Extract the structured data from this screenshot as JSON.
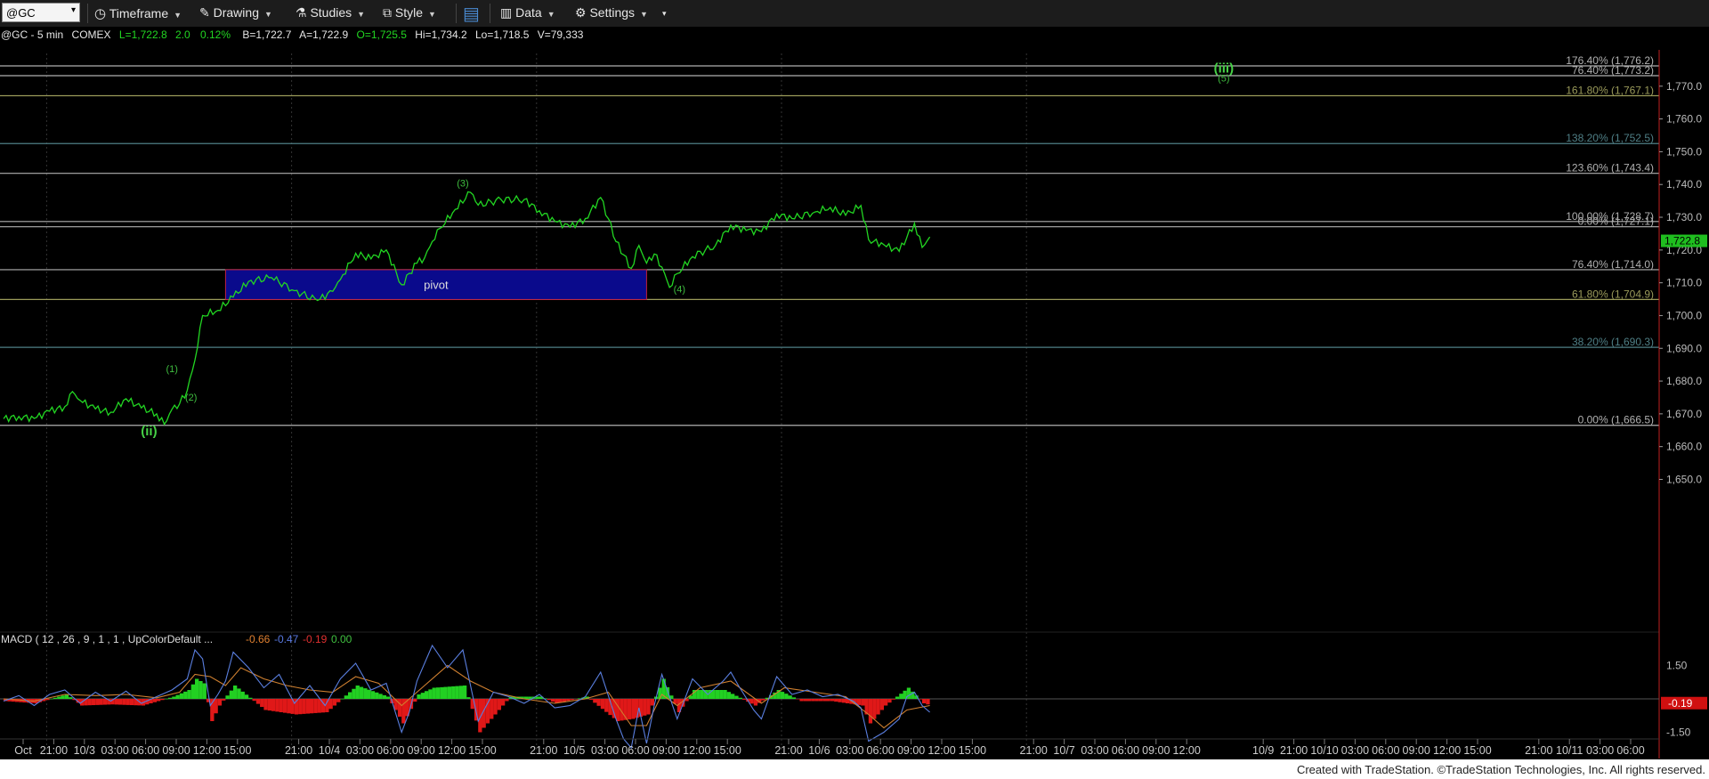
{
  "toolbar": {
    "symbol": "@GC",
    "timeframe_label": "Timeframe",
    "drawing_label": "Drawing",
    "studies_label": "Studies",
    "style_label": "Style",
    "data_label": "Data",
    "settings_label": "Settings"
  },
  "header": {
    "instrument": "@GC - 5 min",
    "exchange": "COMEX",
    "last": "L=1,722.8",
    "change": "2.0",
    "pct": "0.12%",
    "bid": "B=1,722.7",
    "ask": "A=1,722.9",
    "open": "O=1,725.5",
    "high": "Hi=1,734.2",
    "low": "Lo=1,718.5",
    "volume": "V=79,333"
  },
  "footer_text": "Created with TradeStation. ©TradeStation Technologies, Inc. All rights reserved.",
  "chart_data": {
    "type": "line",
    "ylim": [
      1636,
      1780
    ],
    "y_ticks": [
      "1,770.0",
      "1,760.0",
      "1,750.0",
      "1,740.0",
      "1,730.0",
      "1,720.0",
      "1,710.0",
      "1,700.0",
      "1,690.0",
      "1,680.0",
      "1,670.0",
      "1,660.0",
      "1,650.0"
    ],
    "y_tick_values": [
      1770,
      1760,
      1750,
      1740,
      1730,
      1720,
      1710,
      1700,
      1690,
      1680,
      1670,
      1660,
      1650
    ],
    "last_price_label": "1,722.8",
    "last_price": 1722.8,
    "x_labels": [
      "Oct",
      "21:00",
      "10/3",
      "03:00",
      "06:00",
      "09:00",
      "12:00",
      "15:00",
      "21:00",
      "10/4",
      "03:00",
      "06:00",
      "09:00",
      "12:00",
      "15:00",
      "21:00",
      "10/5",
      "03:00",
      "06:00",
      "09:00",
      "12:00",
      "15:00",
      "21:00",
      "10/6",
      "03:00",
      "06:00",
      "09:00",
      "12:00",
      "15:00",
      "21:00",
      "10/7",
      "03:00",
      "06:00",
      "09:00",
      "12:00",
      "10/9",
      "21:00",
      "10/10",
      "03:00",
      "06:00",
      "09:00",
      "12:00",
      "15:00",
      "21:00",
      "10/11",
      "03:00",
      "06:00"
    ],
    "x_label_index": [
      0,
      4,
      8,
      12,
      16,
      20,
      24,
      28,
      36,
      40,
      44,
      48,
      52,
      56,
      60,
      68,
      72,
      76,
      80,
      84,
      88,
      92,
      100,
      104,
      108,
      112,
      116,
      120,
      124,
      132,
      136,
      140,
      144,
      148,
      152,
      162,
      166,
      170,
      174,
      178,
      182,
      186,
      190,
      198,
      202,
      206,
      210
    ],
    "price_series": [
      [
        0,
        1668.5
      ],
      [
        2,
        1669.2
      ],
      [
        4,
        1668.6
      ],
      [
        6,
        1670.8
      ],
      [
        8,
        1672.2
      ],
      [
        9,
        1676.8
      ],
      [
        10,
        1674.1
      ],
      [
        12,
        1671.5
      ],
      [
        14,
        1670.5
      ],
      [
        16,
        1674.6
      ],
      [
        18,
        1671.8
      ],
      [
        20,
        1670.0
      ],
      [
        21,
        1666.8
      ],
      [
        22,
        1671.4
      ],
      [
        23,
        1673.1
      ],
      [
        24,
        1677.2
      ],
      [
        25,
        1686.4
      ],
      [
        26,
        1700.0
      ],
      [
        28,
        1701.6
      ],
      [
        30,
        1705.6
      ],
      [
        32,
        1710.4
      ],
      [
        35,
        1711.6
      ],
      [
        38,
        1707.6
      ],
      [
        41,
        1704.6
      ],
      [
        43,
        1707.4
      ],
      [
        44,
        1711.0
      ],
      [
        46,
        1719.0
      ],
      [
        48,
        1717.3
      ],
      [
        50,
        1720.0
      ],
      [
        52,
        1709.4
      ],
      [
        54,
        1716.0
      ],
      [
        55,
        1717.6
      ],
      [
        56,
        1722.6
      ],
      [
        57,
        1726.6
      ],
      [
        59,
        1732.4
      ],
      [
        61,
        1737.6
      ],
      [
        62,
        1733.7
      ],
      [
        65,
        1735.4
      ],
      [
        68,
        1735.4
      ],
      [
        70,
        1732.0
      ],
      [
        72,
        1728.8
      ],
      [
        74,
        1727.0
      ],
      [
        76,
        1729.6
      ],
      [
        78,
        1736.0
      ],
      [
        79,
        1729.6
      ],
      [
        80,
        1722.6
      ],
      [
        82,
        1714.4
      ],
      [
        83,
        1721.4
      ],
      [
        84,
        1716.0
      ],
      [
        85,
        1718.8
      ],
      [
        86,
        1714.8
      ],
      [
        87,
        1708.6
      ],
      [
        88,
        1712.8
      ],
      [
        90,
        1718.0
      ],
      [
        93,
        1721.4
      ],
      [
        95,
        1727.6
      ],
      [
        97,
        1726.0
      ],
      [
        99,
        1725.6
      ],
      [
        101,
        1731.0
      ],
      [
        103,
        1729.6
      ],
      [
        106,
        1731.6
      ],
      [
        108,
        1733.0
      ],
      [
        110,
        1730.6
      ],
      [
        112,
        1733.6
      ],
      [
        113,
        1723.2
      ],
      [
        115,
        1721.6
      ],
      [
        117,
        1719.6
      ],
      [
        119,
        1728.2
      ],
      [
        120,
        1720.8
      ],
      [
        121,
        1724.0
      ]
    ],
    "fib_levels": [
      {
        "label": "176.40% (1,776.2)",
        "value": 1776.2,
        "color": "#b0b0b0"
      },
      {
        "label": "76.40% (1,773.2)",
        "value": 1773.2,
        "color": "#b0b0b0"
      },
      {
        "label": "161.80% (1,767.1)",
        "value": 1767.1,
        "color": "#9a9a5a"
      },
      {
        "label": "138.20% (1,752.5)",
        "value": 1752.5,
        "color": "#4f7f86"
      },
      {
        "label": "123.60% (1,743.4)",
        "value": 1743.4,
        "color": "#b0b0b0"
      },
      {
        "label": "100.00% (1,728.7)",
        "value": 1728.7,
        "color": "#b0b0b0"
      },
      {
        "label": "0.00% (1,727.1)",
        "value": 1727.1,
        "color": "#b0b0b0"
      },
      {
        "label": "76.40% (1,714.0)",
        "value": 1714.0,
        "color": "#b0b0b0"
      },
      {
        "label": "61.80% (1,704.9)",
        "value": 1704.9,
        "color": "#9a9a5a"
      },
      {
        "label": "38.20% (1,690.3)",
        "value": 1690.3,
        "color": "#4f7f86"
      },
      {
        "label": "0.00% (1,666.5)",
        "value": 1666.5,
        "color": "#b0b0b0"
      }
    ],
    "pivot": {
      "label": "pivot",
      "x_start": 29,
      "x_end": 84,
      "y_top": 1714.0,
      "y_bottom": 1704.9
    },
    "wave_labels": [
      {
        "text": "(ii)",
        "x": 19,
        "y": 1663.5,
        "bold": true
      },
      {
        "text": "(1)",
        "x": 22,
        "y": 1682.7,
        "bold": false
      },
      {
        "text": "(2)",
        "x": 24.5,
        "y": 1674.1,
        "bold": false
      },
      {
        "text": "(3)",
        "x": 60,
        "y": 1739.4,
        "bold": false
      },
      {
        "text": "(4)",
        "x": 88.3,
        "y": 1707.1,
        "bold": false
      },
      {
        "text": "(iii)",
        "x": 159.4,
        "y": 1774.2,
        "bold": true
      },
      {
        "text": "(5)",
        "x": 159.4,
        "y": 1771.4,
        "bold": false
      }
    ],
    "macd": {
      "label": "MACD ( 12 , 26 , 9 , 1 , 1 , UpColorDefault ...",
      "values": [
        "-0.66",
        "-0.47",
        "-0.19",
        "0.00"
      ],
      "value_colors": [
        "#e08030",
        "#5878e0",
        "#e03030",
        "#40c040"
      ],
      "ylim": [
        -2.2,
        2.2
      ],
      "ticks": [
        "1.50",
        "-1.50"
      ],
      "tick_values": [
        1.5,
        -1.5
      ],
      "last_label": "-0.19",
      "last_value": -0.19,
      "macd_series": [
        [
          0,
          -0.1
        ],
        [
          2,
          0.15
        ],
        [
          4,
          -0.3
        ],
        [
          6,
          0.2
        ],
        [
          8,
          0.4
        ],
        [
          10,
          -0.2
        ],
        [
          12,
          0.3
        ],
        [
          14,
          -0.1
        ],
        [
          16,
          0.35
        ],
        [
          18,
          -0.2
        ],
        [
          20,
          0.1
        ],
        [
          22,
          0.4
        ],
        [
          24,
          0.9
        ],
        [
          25,
          2.2
        ],
        [
          26,
          1.8
        ],
        [
          27,
          -0.3
        ],
        [
          28,
          0.2
        ],
        [
          29,
          0.8
        ],
        [
          30,
          2.1
        ],
        [
          32,
          1.4
        ],
        [
          34,
          0.5
        ],
        [
          36,
          1.1
        ],
        [
          38,
          -0.2
        ],
        [
          40,
          0.6
        ],
        [
          42,
          -0.3
        ],
        [
          44,
          0.9
        ],
        [
          46,
          1.6
        ],
        [
          48,
          0.4
        ],
        [
          50,
          0.7
        ],
        [
          52,
          -1.5
        ],
        [
          53,
          -0.6
        ],
        [
          54,
          0.8
        ],
        [
          56,
          2.4
        ],
        [
          58,
          1.4
        ],
        [
          60,
          2.2
        ],
        [
          62,
          -1.0
        ],
        [
          64,
          0.3
        ],
        [
          66,
          0.1
        ],
        [
          68,
          -0.2
        ],
        [
          70,
          0.2
        ],
        [
          72,
          -0.4
        ],
        [
          74,
          -0.3
        ],
        [
          76,
          0.1
        ],
        [
          78,
          1.2
        ],
        [
          80,
          -0.9
        ],
        [
          81,
          -1.8
        ],
        [
          82,
          -2.2
        ],
        [
          83,
          -0.4
        ],
        [
          84,
          -2.0
        ],
        [
          85,
          -0.3
        ],
        [
          86,
          1.1
        ],
        [
          88,
          -0.9
        ],
        [
          90,
          0.9
        ],
        [
          92,
          0.2
        ],
        [
          94,
          0.8
        ],
        [
          95,
          1.2
        ],
        [
          96,
          0.6
        ],
        [
          98,
          -0.5
        ],
        [
          99,
          -0.9
        ],
        [
          101,
          1.0
        ],
        [
          103,
          0.2
        ],
        [
          105,
          0.4
        ],
        [
          107,
          0.1
        ],
        [
          109,
          0.2
        ],
        [
          111,
          -0.1
        ],
        [
          112,
          -0.4
        ],
        [
          113,
          -1.9
        ],
        [
          115,
          -1.5
        ],
        [
          117,
          -0.9
        ],
        [
          118,
          0.1
        ],
        [
          119,
          0.3
        ],
        [
          120,
          -0.3
        ],
        [
          121,
          -0.6
        ]
      ],
      "signal_series": [
        [
          0,
          0.0
        ],
        [
          4,
          -0.1
        ],
        [
          8,
          0.2
        ],
        [
          12,
          0.15
        ],
        [
          16,
          0.2
        ],
        [
          20,
          0.05
        ],
        [
          23,
          0.3
        ],
        [
          25,
          1.1
        ],
        [
          27,
          1.0
        ],
        [
          29,
          0.6
        ],
        [
          31,
          1.4
        ],
        [
          34,
          0.9
        ],
        [
          37,
          0.6
        ],
        [
          40,
          0.4
        ],
        [
          43,
          0.3
        ],
        [
          46,
          1.0
        ],
        [
          49,
          0.7
        ],
        [
          52,
          -0.3
        ],
        [
          55,
          0.6
        ],
        [
          58,
          1.5
        ],
        [
          61,
          0.8
        ],
        [
          64,
          0.3
        ],
        [
          68,
          0.0
        ],
        [
          72,
          -0.2
        ],
        [
          76,
          0.0
        ],
        [
          79,
          0.3
        ],
        [
          82,
          -1.2
        ],
        [
          84,
          -1.2
        ],
        [
          86,
          0.2
        ],
        [
          88,
          -0.3
        ],
        [
          91,
          0.5
        ],
        [
          95,
          0.8
        ],
        [
          99,
          -0.2
        ],
        [
          102,
          0.5
        ],
        [
          106,
          0.3
        ],
        [
          110,
          0.1
        ],
        [
          113,
          -0.7
        ],
        [
          115,
          -1.3
        ],
        [
          118,
          -0.5
        ],
        [
          121,
          -0.3
        ]
      ],
      "hist_series": [
        [
          0,
          -0.1
        ],
        [
          4,
          -0.2
        ],
        [
          8,
          0.2
        ],
        [
          10,
          -0.3
        ],
        [
          14,
          -0.25
        ],
        [
          18,
          -0.3
        ],
        [
          22,
          0.1
        ],
        [
          24,
          0.4
        ],
        [
          25,
          0.9
        ],
        [
          26,
          0.7
        ],
        [
          27,
          -1.0
        ],
        [
          28,
          -0.3
        ],
        [
          30,
          0.6
        ],
        [
          34,
          -0.5
        ],
        [
          38,
          -0.7
        ],
        [
          42,
          -0.6
        ],
        [
          46,
          0.6
        ],
        [
          50,
          0.1
        ],
        [
          52,
          -1.1
        ],
        [
          54,
          0.2
        ],
        [
          56,
          0.5
        ],
        [
          60,
          0.6
        ],
        [
          62,
          -1.5
        ],
        [
          66,
          0.1
        ],
        [
          70,
          0.1
        ],
        [
          72,
          -0.2
        ],
        [
          76,
          0.1
        ],
        [
          80,
          -1.0
        ],
        [
          82,
          -0.9
        ],
        [
          84,
          -0.7
        ],
        [
          86,
          0.9
        ],
        [
          88,
          -0.6
        ],
        [
          90,
          0.4
        ],
        [
          94,
          0.4
        ],
        [
          98,
          -0.3
        ],
        [
          101,
          0.4
        ],
        [
          104,
          -0.1
        ],
        [
          108,
          -0.1
        ],
        [
          112,
          -0.3
        ],
        [
          113,
          -1.1
        ],
        [
          115,
          -0.3
        ],
        [
          118,
          0.5
        ],
        [
          120,
          -0.2
        ],
        [
          121,
          -0.3
        ]
      ]
    }
  }
}
